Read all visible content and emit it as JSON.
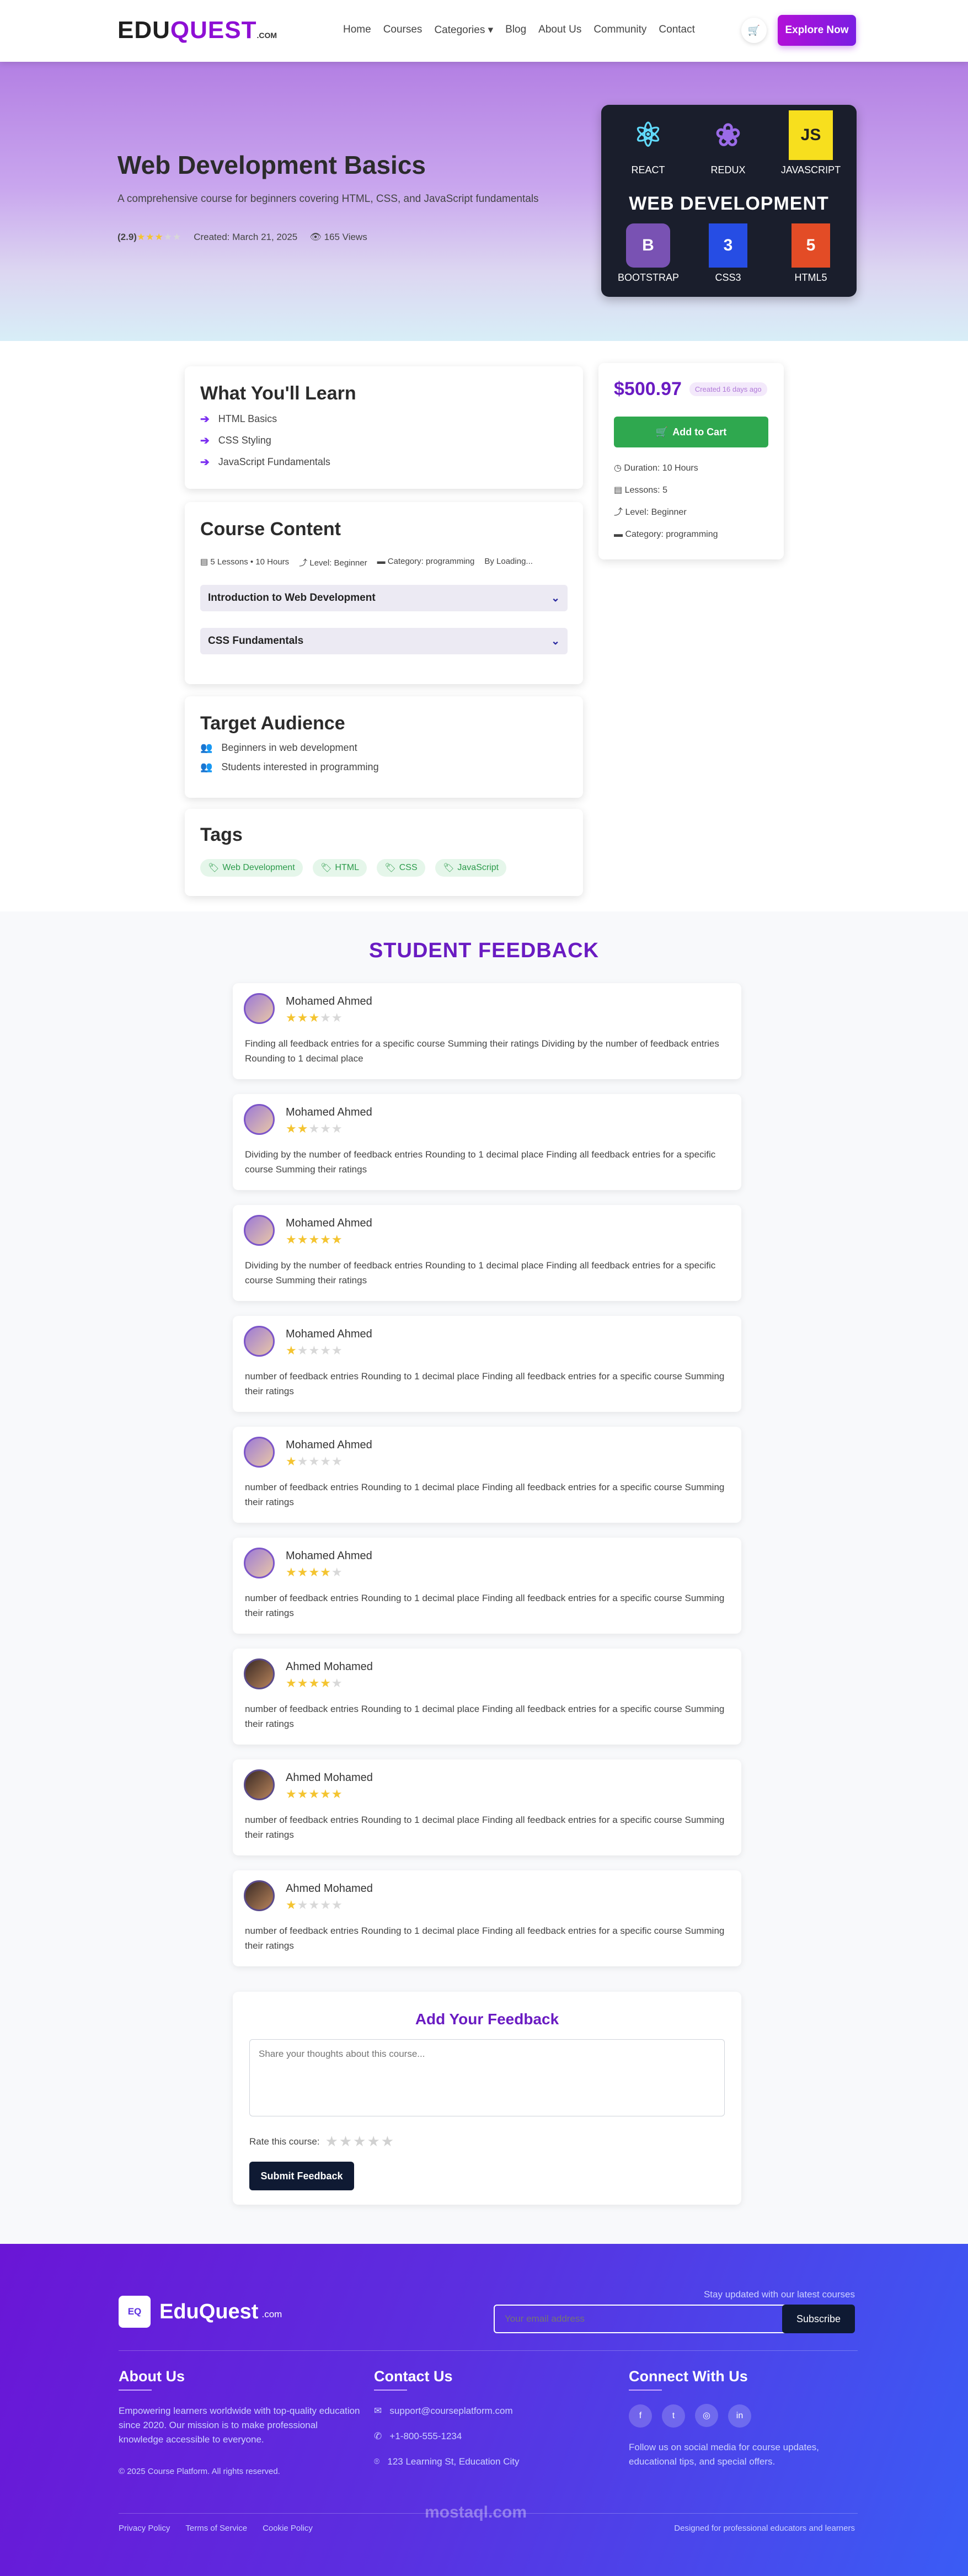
{
  "nav": {
    "logo_a": "EDU",
    "logo_b": "QUEST",
    "logo_c": ".COM",
    "items": [
      "Home",
      "Courses",
      "Categories ▾",
      "Blog",
      "About Us",
      "Community",
      "Contact"
    ],
    "explore": "Explore Now"
  },
  "hero": {
    "title": "Web Development Basics",
    "description": "A comprehensive course for beginners covering HTML, CSS, and JavaScript fundamentals",
    "rating": "(2.9)",
    "rating_value": 2.9,
    "created": "Created: March 21, 2025",
    "views": "165 Views",
    "image": {
      "banner": "WEB DEVELOPMENT",
      "techs": [
        "REACT",
        "REDUX",
        "JAVASCRIPT",
        "BOOTSTRAP",
        "CSS3",
        "HTML5"
      ]
    }
  },
  "learn": {
    "title": "What You'll Learn",
    "items": [
      "HTML Basics",
      "CSS Styling",
      "JavaScript Fundamentals"
    ]
  },
  "content": {
    "title": "Course Content",
    "meta": [
      "5 Lessons • 10 Hours",
      "Level: Beginner",
      "Category: programming",
      "By Loading..."
    ],
    "sections": [
      "Introduction to Web Development",
      "CSS Fundamentals"
    ]
  },
  "audience": {
    "title": "Target Audience",
    "items": [
      "Beginners in web development",
      "Students interested in programming"
    ]
  },
  "tags": {
    "title": "Tags",
    "items": [
      "Web Development",
      "HTML",
      "CSS",
      "JavaScript"
    ]
  },
  "side": {
    "price": "$500.97",
    "created": "Created 16 days ago",
    "add": "Add to Cart",
    "duration": "Duration: 10 Hours",
    "lessons": "Lessons: 5",
    "level": "Level: Beginner",
    "category": "Category: programming"
  },
  "feedback": {
    "title": "STUDENT FEEDBACK",
    "items": [
      {
        "name": "Mohamed Ahmed",
        "stars": 3,
        "text": "Finding all feedback entries for a specific course Summing their ratings Dividing by the number of feedback entries Rounding to 1 decimal place"
      },
      {
        "name": "Mohamed Ahmed",
        "stars": 2,
        "text": "Dividing by the number of feedback entries Rounding to 1 decimal place Finding all feedback entries for a specific course Summing their ratings"
      },
      {
        "name": "Mohamed Ahmed",
        "stars": 5,
        "text": "Dividing by the number of feedback entries Rounding to 1 decimal place Finding all feedback entries for a specific course Summing their ratings"
      },
      {
        "name": "Mohamed Ahmed",
        "stars": 1,
        "text": "number of feedback entries Rounding to 1 decimal place Finding all feedback entries for a specific course Summing their ratings"
      },
      {
        "name": "Mohamed Ahmed",
        "stars": 1,
        "text": "number of feedback entries Rounding to 1 decimal place Finding all feedback entries for a specific course Summing their ratings"
      },
      {
        "name": "Mohamed Ahmed",
        "stars": 4,
        "text": "number of feedback entries Rounding to 1 decimal place Finding all feedback entries for a specific course Summing their ratings"
      },
      {
        "name": "Ahmed Mohamed",
        "stars": 3.5,
        "text": "number of feedback entries Rounding to 1 decimal place Finding all feedback entries for a specific course Summing their ratings"
      },
      {
        "name": "Ahmed Mohamed",
        "stars": 5,
        "text": "number of feedback entries Rounding to 1 decimal place Finding all feedback entries for a specific course Summing their ratings"
      },
      {
        "name": "Ahmed Mohamed",
        "stars": 1,
        "text": "number of feedback entries Rounding to 1 decimal place Finding all feedback entries for a specific course Summing their ratings"
      }
    ]
  },
  "add_feedback": {
    "title": "Add Your Feedback",
    "placeholder": "Share your thoughts about this course...",
    "rate": "Rate this course:",
    "submit": "Submit Feedback"
  },
  "footer": {
    "logo_badge": "EQ",
    "logo": "EduQuest",
    "logo_suffix": ".com",
    "newsletter": "Stay updated with our latest courses",
    "email_placeholder": "Your email address",
    "subscribe": "Subscribe",
    "about_title": "About Us",
    "about_text": "Empowering learners worldwide with top-quality education since 2020. Our mission is to make professional knowledge accessible to everyone.",
    "copyright": "© 2025 Course Platform. All rights reserved.",
    "contact_title": "Contact Us",
    "email": "support@courseplatform.com",
    "phone": "+1-800-555-1234",
    "address": "123 Learning St, Education City",
    "connect_title": "Connect With Us",
    "connect_text": "Follow us on social media for course updates, educational tips, and special offers.",
    "links": [
      "Privacy Policy",
      "Terms of Service",
      "Cookie Policy"
    ],
    "tagline": "Designed for professional educators and learners",
    "watermark": "mostaql.com"
  }
}
